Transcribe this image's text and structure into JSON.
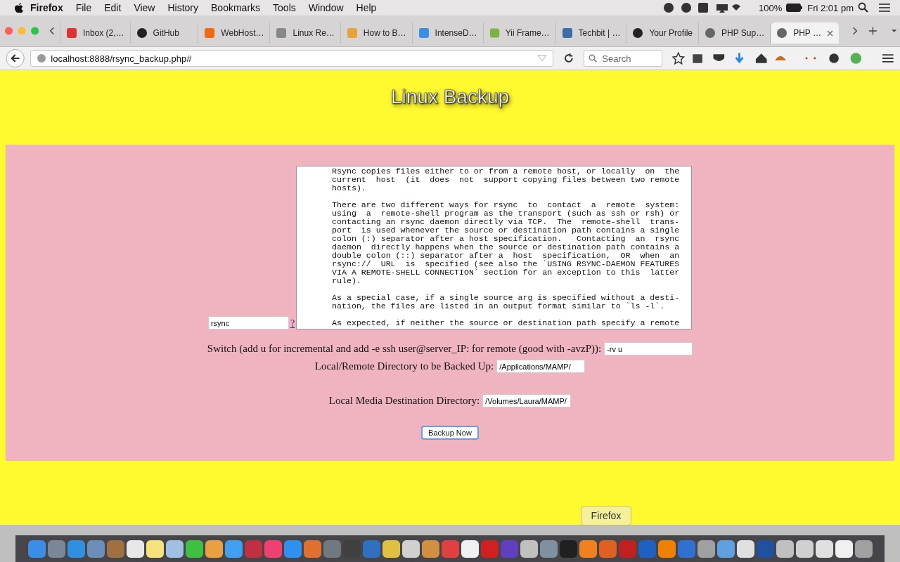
{
  "menu_bar": {
    "app": "Firefox",
    "items": [
      "File",
      "Edit",
      "View",
      "History",
      "Bookmarks",
      "Tools",
      "Window",
      "Help"
    ],
    "battery": "100%",
    "clock": "Fri 2:01 pm"
  },
  "tabs": [
    {
      "label": "Inbox (2,…",
      "selected": false
    },
    {
      "label": "GitHub",
      "selected": false
    },
    {
      "label": "WebHost…",
      "selected": false
    },
    {
      "label": "Linux Re…",
      "selected": false
    },
    {
      "label": "How to B…",
      "selected": false
    },
    {
      "label": "IntenseD…",
      "selected": false
    },
    {
      "label": "Yii Frame…",
      "selected": false
    },
    {
      "label": "Techbit | …",
      "selected": false
    },
    {
      "label": "Your Profile",
      "selected": false
    },
    {
      "label": "PHP Sup…",
      "selected": false
    },
    {
      "label": "PHP …",
      "selected": true
    }
  ],
  "nav": {
    "url": "localhost:8888/rsync_backup.php#",
    "search_placeholder": "Search"
  },
  "page": {
    "title": "Linux Backup",
    "command": {
      "value": "rsync",
      "help_link": "?"
    },
    "manual_paragraphs": [
      [
        "Rsync copies files either to or from a remote host, or locally  on  the",
        "current  host  (it  does  not  support copying files between two remote",
        "hosts)."
      ],
      [
        "There are two different ways for rsync  to  contact  a  remote  system:",
        "using  a  remote-shell program as the transport (such as ssh or rsh) or",
        "contacting an rsync daemon directly via TCP.  The  remote-shell  trans-",
        "port  is used whenever the source or destination path contains a single",
        "colon (:) separator after a host specification.   Contacting  an  rsync",
        "daemon  directly happens when the source or destination path contains a",
        "double colon (::) separator after a  host  specification,  OR  when  an",
        "rsync://  URL  is  specified (see also the `USING RSYNC-DAEMON FEATURES",
        "VIA A REMOTE-SHELL CONNECTION` section for an exception to this  latter",
        "rule)."
      ],
      [
        "As a special case, if a single source arg is specified without a desti-",
        "nation, the files are listed in an output format similar to `ls -l`."
      ],
      [
        "As expected, if neither the source or destination path specify a remote"
      ]
    ],
    "fields": [
      {
        "label": "Switch (add u for incremental and add -e ssh user@server_IP: for remote (good with -avzP)):",
        "value": "-rv u"
      },
      {
        "label": "Local/Remote Directory to be Backed Up:",
        "value": "/Applications/MAMP/"
      },
      {
        "label": "Local Media Destination Directory:",
        "value": "/Volumes/Laura/MAMP/"
      }
    ],
    "button": "Backup Now"
  },
  "dock": {
    "tooltip": "Firefox"
  }
}
